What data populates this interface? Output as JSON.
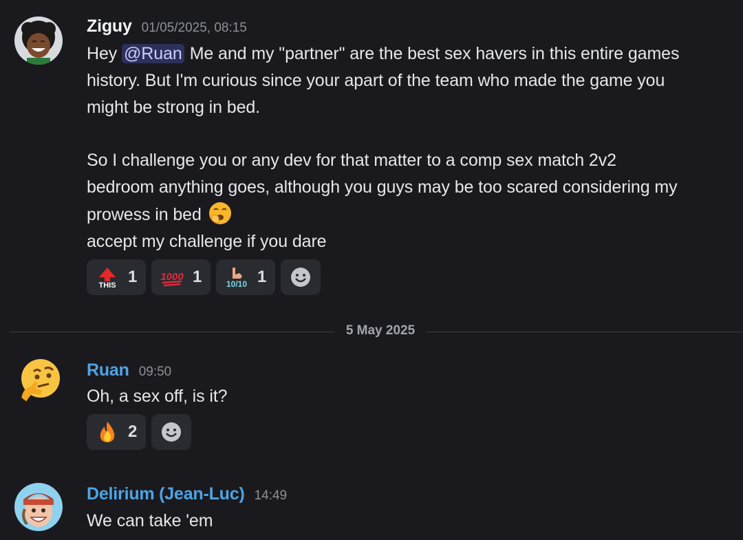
{
  "messages": [
    {
      "author": "Ziguy",
      "timestamp": "01/05/2025, 08:15",
      "avatar_icon": "dark-haired-smiling-avatar",
      "mention": "@Ruan",
      "lines": [
        "Me and my \"partner\" are the best sex havers in this entire games",
        "history. But I'm curious since your apart of the team who made the game you",
        "might be strong in bed.",
        "So I challenge you or any dev for that matter to a comp sex match 2v2",
        "bedroom anything goes, although you guys may be too scared considering my",
        "prowess in bed",
        "accept my challenge if you dare"
      ],
      "line1_prefix": "Hey",
      "inline_emoji": "yawning-face-emoji",
      "reactions": [
        {
          "icon": "this-up-arrow-emoji",
          "count": "1",
          "label": "THIS"
        },
        {
          "icon": "hundred-points-emoji",
          "count": "1",
          "label": "1000"
        },
        {
          "icon": "ten-out-of-ten-hand-emoji",
          "count": "1",
          "label": "10/10"
        }
      ]
    },
    {
      "author": "Ruan",
      "timestamp": "09:50",
      "avatar_icon": "thinking-face-emoji-avatar",
      "text": "Oh, a sex off, is it?",
      "reactions": [
        {
          "icon": "fire-emoji",
          "count": "2"
        }
      ]
    },
    {
      "author": "Delirium (Jean-Luc)",
      "timestamp": "14:49",
      "avatar_icon": "cartoon-man-with-cap-avatar",
      "text": "We can take 'em"
    }
  ],
  "date_divider": "5 May 2025",
  "colors": {
    "background": "#1a1a1e",
    "reaction_bg": "#2a2b30",
    "author_blue": "#4ea4e6",
    "mention_bg": "#3c4079",
    "timestamp": "#8e9096"
  }
}
